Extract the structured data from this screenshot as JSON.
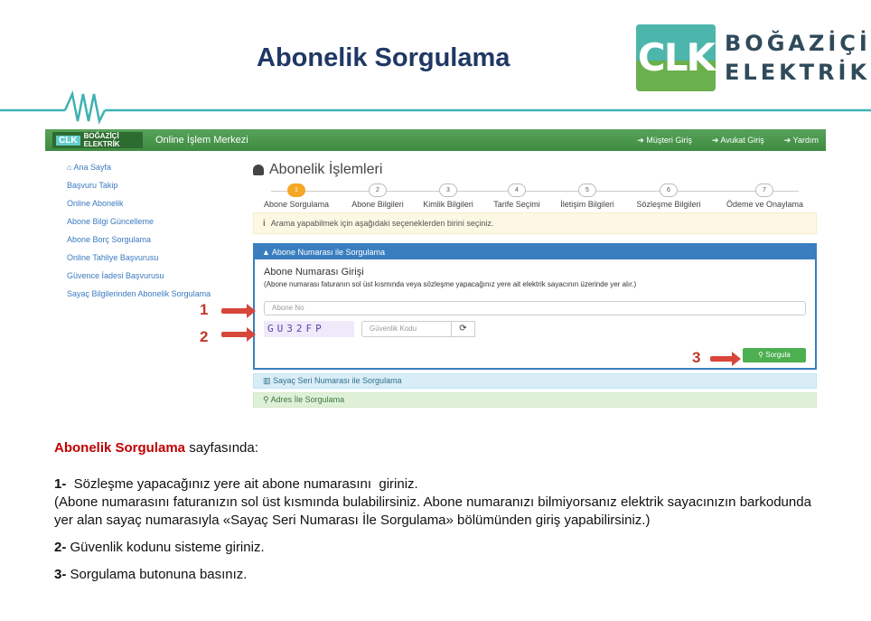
{
  "slide_title": "Abonelik Sorgulama",
  "logo": {
    "mark": "CLK",
    "line1": "BOĞAZİÇİ",
    "line2": "ELEKTRİK"
  },
  "site": {
    "topbar_logo_mark": "CLK",
    "topbar_logo_text": "BOĞAZİÇİ ELEKTRİK",
    "topbar_title": "Online İşlem Merkezi",
    "topbar_links": [
      "Müşteri Giriş",
      "Avukat Giriş",
      "Yardım"
    ],
    "sidebar": [
      "Ana Sayfa",
      "Başvuru Takip",
      "Online Abonelik",
      "Abone Bilgi Güncelleme",
      "Abone Borç Sorgulama",
      "Online Tahliye Başvurusu",
      "Güvence İadesi Başvurusu",
      "Sayaç Bilgilerinden Abonelik Sorgulama"
    ],
    "page_title": "Abonelik İşlemleri",
    "steps": [
      {
        "num": "1",
        "label": "Abone Sorgulama"
      },
      {
        "num": "2",
        "label": "Abone Bilgileri"
      },
      {
        "num": "3",
        "label": "Kimlik Bilgileri"
      },
      {
        "num": "4",
        "label": "Tarife Seçimi"
      },
      {
        "num": "5",
        "label": "İletişim Bilgileri"
      },
      {
        "num": "6",
        "label": "Sözleşme Bilgileri"
      },
      {
        "num": "7",
        "label": "Ödeme ve Onaylama"
      }
    ],
    "alert": "Arama yapabilmek için aşağıdaki seçeneklerden birini seçiniz.",
    "panel_title": "Abone Numarası ile Sorgulama",
    "panel_heading": "Abone Numarası Girişi",
    "panel_note": "(Abone numarası faturanın sol üst kısmında veya sözleşme yapacağınız yere ait elektrik sayacının üzerinde yer alır.)",
    "abone_placeholder": "Abone No",
    "captcha_text": "GU32FP",
    "code_placeholder": "Güvenlik Kodu",
    "sorgula_label": "Sorgula",
    "accordion_seri": "Sayaç Seri Numarası ile Sorgulama",
    "accordion_adres": "Adres İle Sorgulama"
  },
  "markers": [
    "1",
    "2",
    "3"
  ],
  "instructions": {
    "intro_bold": "Abonelik Sorgulama",
    "intro_rest": " sayfasında:",
    "step1_num": "1-",
    "step1_text": "  Sözleşme yapacağınız yere ait abone numarasını  giriniz.",
    "step1_note": "(Abone numarasını faturanızın sol üst kısmında bulabilirsiniz.  Abone numaranızı bilmiyorsanız elektrik sayacınızın barkodunda yer alan sayaç  numarasıyla  «Sayaç Seri Numarası İle Sorgulama» bölümünden giriş yapabilirsiniz.)",
    "step2_num": "2-",
    "step2_text": " Güvenlik kodunu sisteme giriniz.",
    "step3_num": "3-",
    "step3_text": " Sorgulama butonuna basınız."
  },
  "colors": {
    "title": "#1f3864",
    "accent_red": "#c00000",
    "green": "#4caf50",
    "blue": "#3a7ebf",
    "teal": "#4db6ac"
  }
}
